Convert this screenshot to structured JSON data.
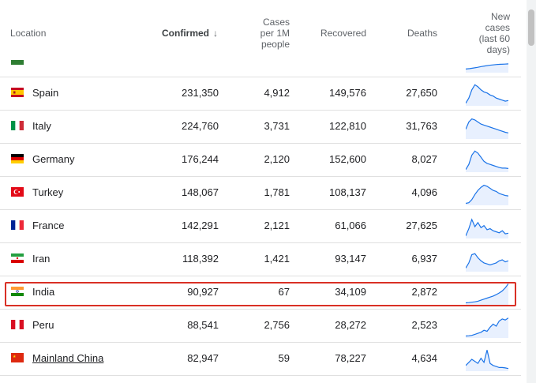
{
  "columns": {
    "location": "Location",
    "confirmed": "Confirmed",
    "per_capita_lines": [
      "Cases",
      "per 1M",
      "people"
    ],
    "recovered": "Recovered",
    "deaths": "Deaths",
    "new_cases_lines": [
      "New",
      "cases",
      "(last 60",
      "days)"
    ]
  },
  "sort_icon": "arrow-down-icon",
  "rows": [
    {
      "name": "",
      "flag": "partial-flag",
      "confirmed": "",
      "per_capita": "",
      "recovered": "",
      "deaths": "",
      "partial": true,
      "trend": [
        0.1,
        0.12,
        0.15,
        0.18,
        0.22,
        0.25,
        0.28,
        0.3,
        0.32,
        0.33,
        0.34,
        0.35
      ]
    },
    {
      "name": "Spain",
      "flag": "spain-flag",
      "confirmed": "231,350",
      "per_capita": "4,912",
      "recovered": "149,576",
      "deaths": "27,650",
      "trend": [
        0.05,
        0.3,
        0.7,
        0.95,
        0.85,
        0.7,
        0.6,
        0.55,
        0.45,
        0.4,
        0.3,
        0.25,
        0.2,
        0.15,
        0.18
      ]
    },
    {
      "name": "Italy",
      "flag": "italy-flag",
      "confirmed": "224,760",
      "per_capita": "3,731",
      "recovered": "122,810",
      "deaths": "31,763",
      "trend": [
        0.4,
        0.75,
        0.9,
        0.85,
        0.75,
        0.65,
        0.6,
        0.55,
        0.5,
        0.45,
        0.4,
        0.35,
        0.3,
        0.25,
        0.22
      ]
    },
    {
      "name": "Germany",
      "flag": "germany-flag",
      "confirmed": "176,244",
      "per_capita": "2,120",
      "recovered": "152,600",
      "deaths": "8,027",
      "trend": [
        0.05,
        0.3,
        0.75,
        0.95,
        0.85,
        0.65,
        0.45,
        0.35,
        0.3,
        0.25,
        0.2,
        0.15,
        0.12,
        0.12,
        0.1
      ]
    },
    {
      "name": "Turkey",
      "flag": "turkey-flag",
      "confirmed": "148,067",
      "per_capita": "1,781",
      "recovered": "108,137",
      "deaths": "4,096",
      "trend": [
        0.02,
        0.05,
        0.2,
        0.45,
        0.65,
        0.8,
        0.9,
        0.85,
        0.75,
        0.65,
        0.6,
        0.5,
        0.45,
        0.4,
        0.38
      ]
    },
    {
      "name": "France",
      "flag": "france-flag",
      "confirmed": "142,291",
      "per_capita": "2,121",
      "recovered": "61,066",
      "deaths": "27,625",
      "trend": [
        0.05,
        0.4,
        0.85,
        0.5,
        0.7,
        0.45,
        0.55,
        0.35,
        0.4,
        0.3,
        0.25,
        0.2,
        0.3,
        0.15,
        0.18
      ]
    },
    {
      "name": "Iran",
      "flag": "iran-flag",
      "confirmed": "118,392",
      "per_capita": "1,421",
      "recovered": "93,147",
      "deaths": "6,937",
      "trend": [
        0.1,
        0.35,
        0.75,
        0.8,
        0.6,
        0.45,
        0.35,
        0.3,
        0.25,
        0.3,
        0.35,
        0.45,
        0.5,
        0.4,
        0.45
      ]
    },
    {
      "name": "India",
      "flag": "india-flag",
      "confirmed": "90,927",
      "per_capita": "67",
      "recovered": "34,109",
      "deaths": "2,872",
      "trend": [
        0.02,
        0.03,
        0.05,
        0.07,
        0.1,
        0.15,
        0.2,
        0.25,
        0.3,
        0.35,
        0.42,
        0.5,
        0.6,
        0.75,
        0.95
      ]
    },
    {
      "name": "Peru",
      "flag": "peru-flag",
      "confirmed": "88,541",
      "per_capita": "2,756",
      "recovered": "28,272",
      "deaths": "2,523",
      "trend": [
        0.02,
        0.03,
        0.05,
        0.1,
        0.15,
        0.2,
        0.3,
        0.25,
        0.45,
        0.6,
        0.5,
        0.75,
        0.85,
        0.8,
        0.9
      ]
    },
    {
      "name": "Mainland China",
      "flag": "china-flag",
      "confirmed": "82,947",
      "per_capita": "59",
      "recovered": "78,227",
      "deaths": "4,634",
      "link": true,
      "trend": [
        0.2,
        0.35,
        0.5,
        0.4,
        0.3,
        0.55,
        0.35,
        0.95,
        0.3,
        0.2,
        0.15,
        0.1,
        0.1,
        0.08,
        0.05
      ]
    }
  ],
  "colors": {
    "accent": "#1a73e8",
    "highlight": "#d93025",
    "spark_fill": "#e8f0fe"
  }
}
